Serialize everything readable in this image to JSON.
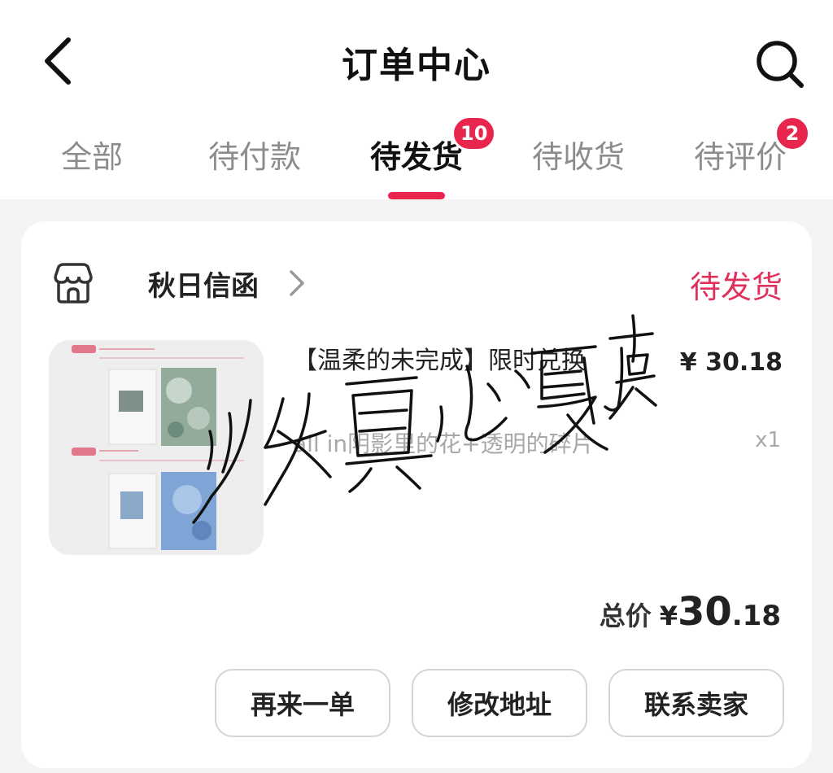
{
  "header": {
    "title": "订单中心",
    "back_icon": "chevron-left-icon",
    "search_icon": "search-icon"
  },
  "tabs": [
    {
      "label": "全部",
      "badge": null,
      "active": false
    },
    {
      "label": "待付款",
      "badge": null,
      "active": false
    },
    {
      "label": "待发货",
      "badge": "10",
      "active": true
    },
    {
      "label": "待收货",
      "badge": null,
      "active": false
    },
    {
      "label": "待评价",
      "badge": "2",
      "active": false
    }
  ],
  "order": {
    "shop_name": "秋日信函",
    "shop_icon": "store-icon",
    "status": "待发货",
    "product": {
      "title": "【温柔的未完成】限时兑换",
      "price": "¥ 30.18",
      "variant": "all in阴影里的花+透明的碎片",
      "quantity": "x1"
    },
    "total": {
      "label": "总价",
      "currency": "¥",
      "integer": "30",
      "decimal": ".18"
    },
    "actions": {
      "reorder": "再来一单",
      "change_address": "修改地址",
      "contact_seller": "联系卖家"
    }
  },
  "colors": {
    "accent": "#e8254d",
    "status_text": "#e0305c",
    "inactive_tab": "#8c8c8c"
  }
}
